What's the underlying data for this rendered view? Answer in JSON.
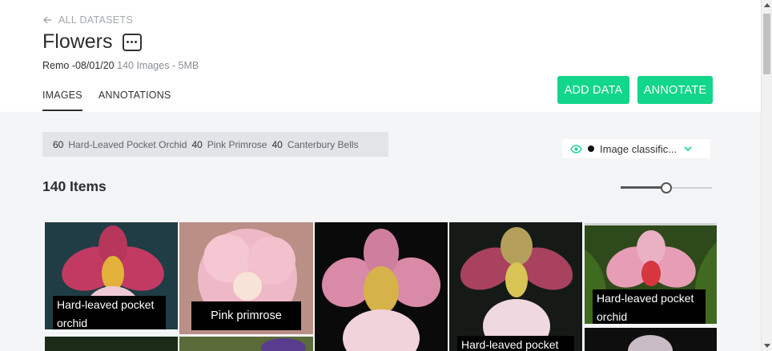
{
  "header": {
    "back_label": "ALL DATASETS",
    "title": "Flowers",
    "owner": "Remo -08/01/20",
    "stats": "140 Images - 5MB",
    "tabs": [
      {
        "label": "IMAGES",
        "active": true
      },
      {
        "label": "ANNOTATIONS",
        "active": false
      }
    ],
    "add_data_label": "ADD DATA",
    "annotate_label": "ANNOTATE"
  },
  "label_summary": [
    {
      "count": "60",
      "name": "Hard-Leaved Pocket Orchid"
    },
    {
      "count": "40",
      "name": "Pink Primrose"
    },
    {
      "count": "40",
      "name": "Canterbury Bells"
    }
  ],
  "view_select": {
    "value": "Image classific...",
    "icons": [
      "eye-icon",
      "chevron-down-icon"
    ],
    "accent": "#12d68a"
  },
  "items_count": "140 Items",
  "thumbnail_size_level": 0.5,
  "captions": {
    "orchid": "Hard-leaved pocket orchid",
    "orchid_line1": "Hard-leaved pocket",
    "orchid_line2": "orchid",
    "primrose": "Pink primrose"
  },
  "colors": {
    "accent": "#12d68a",
    "background": "#f4f5f6"
  }
}
